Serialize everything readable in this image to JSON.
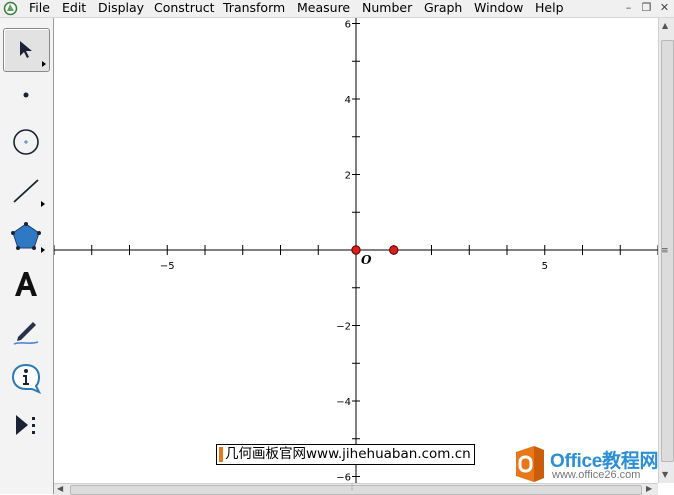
{
  "menubar": {
    "items": [
      "File",
      "Edit",
      "Display",
      "Construct",
      "Transform",
      "Measure",
      "Number",
      "Graph",
      "Window",
      "Help"
    ],
    "window_controls": [
      "minimize",
      "restore",
      "close"
    ]
  },
  "toolbox": {
    "tools": [
      {
        "name": "selection-arrow-tool",
        "icon": "arrow-icon",
        "selected": true
      },
      {
        "name": "point-tool",
        "icon": "point-icon",
        "selected": false
      },
      {
        "name": "compass-tool",
        "icon": "circle-icon",
        "selected": false
      },
      {
        "name": "straightedge-tool",
        "icon": "line-segment-icon",
        "selected": false
      },
      {
        "name": "polygon-tool",
        "icon": "pentagon-icon",
        "selected": false
      },
      {
        "name": "text-tool",
        "icon": "letter-a-icon",
        "selected": false
      },
      {
        "name": "marker-tool",
        "icon": "pen-icon",
        "selected": false
      },
      {
        "name": "information-tool",
        "icon": "info-icon",
        "selected": false
      },
      {
        "name": "custom-tool",
        "icon": "play-more-icon",
        "selected": false
      }
    ]
  },
  "graph": {
    "x_ticks": [
      "-5",
      "5"
    ],
    "y_ticks": [
      "6",
      "4",
      "2",
      "-2",
      "-4",
      "-6"
    ],
    "origin_label": "O",
    "points": [
      {
        "x": 0,
        "y": 0,
        "color": "#d91e1e"
      },
      {
        "x": 1,
        "y": 0,
        "color": "#d91e1e"
      }
    ],
    "axis_color": "#000000"
  },
  "watermark": {
    "text": "几何画板官网www.jihehuaban.com.cn",
    "brand_title": "Office教程网",
    "brand_url": "www.office26.com",
    "brand_color": "#2b8fd6",
    "brand_icon_color": "#e8761a"
  }
}
